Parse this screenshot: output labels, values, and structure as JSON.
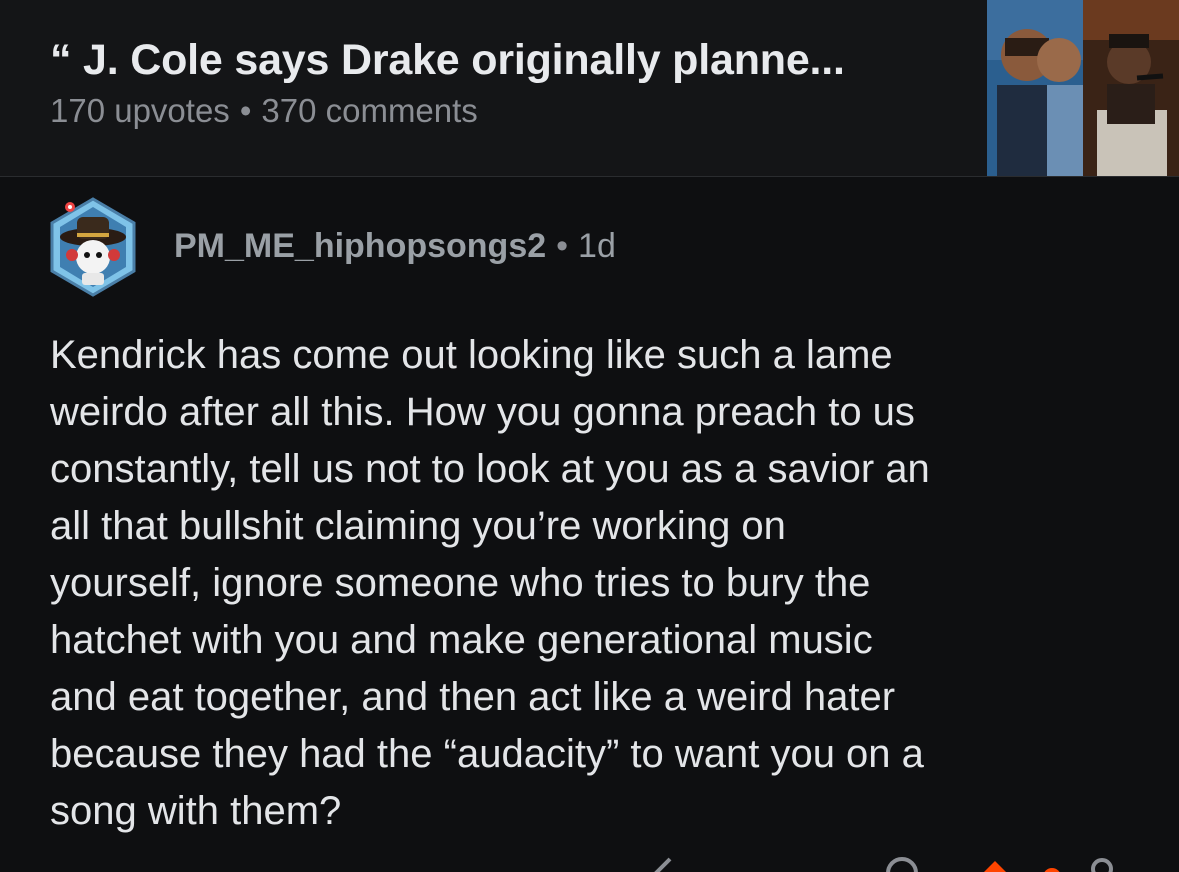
{
  "post": {
    "title": "“ J. Cole says Drake originally planne...",
    "upvotes": "170 upvotes",
    "separator": "•",
    "comments": "370 comments",
    "thumbnail_icon": "post-thumbnail-image"
  },
  "comment": {
    "avatar_icon": "snoo-avatar-icon",
    "username": "PM_ME_hiphopsongs2",
    "separator": "•",
    "age": "1d",
    "body": "Kendrick has come out looking like such a lame\nweirdo after all this. How you gonna preach to us\nconstantly, tell us not to look at you as a savior an\nall that bullshit claiming you’re working on\nyourself, ignore someone who tries to bury the\nhatchet with you and make generational music\nand eat together, and then act like a weird hater\nbecause they had the “audacity” to want you on a\nsong with them?"
  },
  "actions": {
    "reply_icon": "reply-icon",
    "award_icon": "award-icon",
    "upvote_icon": "upvote-icon"
  },
  "colors": {
    "background": "#0e0f11",
    "header_background": "#141517",
    "upvote_accent": "#ff4500"
  }
}
